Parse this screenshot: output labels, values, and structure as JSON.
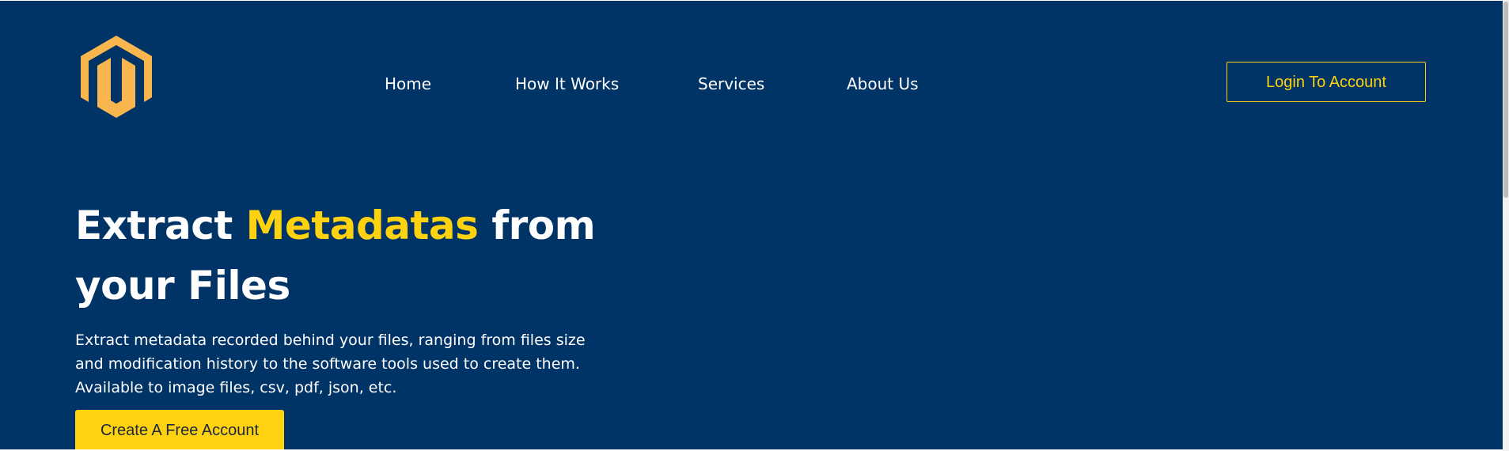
{
  "nav": {
    "items": [
      {
        "label": "Home"
      },
      {
        "label": "How It Works"
      },
      {
        "label": "Services"
      },
      {
        "label": "About Us"
      }
    ],
    "login_label": "Login To Account"
  },
  "hero": {
    "title_before": "Extract ",
    "title_accent": "Metadatas",
    "title_after": " from your Files",
    "description_lines": [
      "Extract metadata recorded behind your files, ranging from files size",
      "and modification history to the software tools used to create them.",
      "Available to image files, csv, pdf, json, etc."
    ],
    "cta_label": "Create A Free Account"
  },
  "colors": {
    "background": "#003366",
    "accent": "#ffd20f",
    "logo": "#f9b64f"
  },
  "icons": {
    "logo": "hexagon-logo-icon"
  }
}
